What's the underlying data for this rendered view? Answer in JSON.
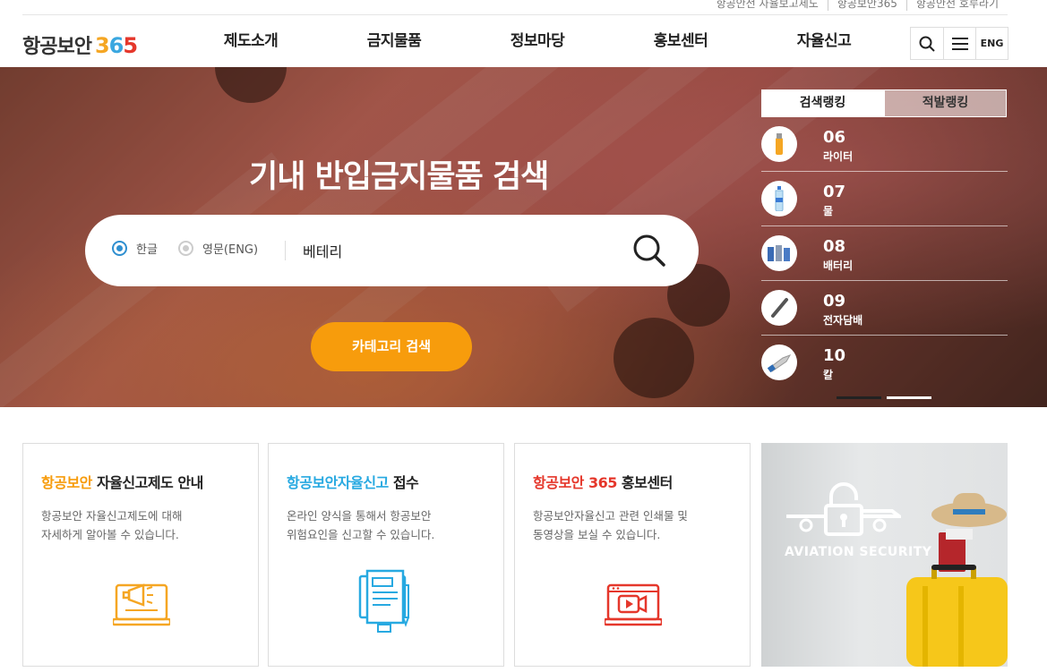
{
  "util_links": [
    "항공안전 자율보고제도",
    "항공보안365",
    "항공안전 호루라기"
  ],
  "logo": {
    "text": "항공보안",
    "num3": "3",
    "num6": "6",
    "num5": "5"
  },
  "gnb": [
    "제도소개",
    "금지물품",
    "정보마당",
    "홍보센터",
    "자율신고"
  ],
  "tools": {
    "search_icon": "search-icon",
    "menu_icon": "menu-icon",
    "lang": "ENG"
  },
  "hero": {
    "title": "기내 반입금지물품 검색",
    "radio_korean": "한글",
    "radio_english": "영문(ENG)",
    "search_value": "베테리",
    "category_button": "카테고리 검색"
  },
  "ranking": {
    "tab_search": "검색랭킹",
    "tab_violation": "적발랭킹",
    "items": [
      {
        "num": "06",
        "name": "라이터",
        "icon": "lighter-icon"
      },
      {
        "num": "07",
        "name": "물",
        "icon": "water-bottle-icon"
      },
      {
        "num": "08",
        "name": "배터리",
        "icon": "battery-icon"
      },
      {
        "num": "09",
        "name": "전자담배",
        "icon": "e-cigarette-icon"
      },
      {
        "num": "10",
        "name": "칼",
        "icon": "knife-icon"
      }
    ]
  },
  "cards": [
    {
      "title_accent": "항공보안",
      "title_rest": " 자율신고제도 안내",
      "accent_color": "#f79c0c",
      "desc_line1": "항공보안 자율신고제도에 대해",
      "desc_line2": "자세하게 알아볼 수 있습니다.",
      "icon": "megaphone-laptop-icon"
    },
    {
      "title_accent": "항공보안자율신고",
      "title_rest": " 접수",
      "accent_color": "#27a9e1",
      "desc_line1": "온라인 양식을 통해서 항공보안",
      "desc_line2": "위험요인을 신고할 수 있습니다.",
      "icon": "document-pen-icon"
    },
    {
      "title_accent": "항공보안 365",
      "title_rest": " 홍보센터",
      "accent_color": "#e5372b",
      "desc_line1": "항공보안자율신고 관련 인쇄물 및",
      "desc_line2": "동영상을 보실 수 있습니다.",
      "icon": "video-laptop-icon"
    }
  ],
  "photo": {
    "text": "AVIATION SECURITY"
  },
  "colors": {
    "orange": "#f79c0c",
    "blue": "#27a9e1",
    "red": "#e5372b"
  }
}
